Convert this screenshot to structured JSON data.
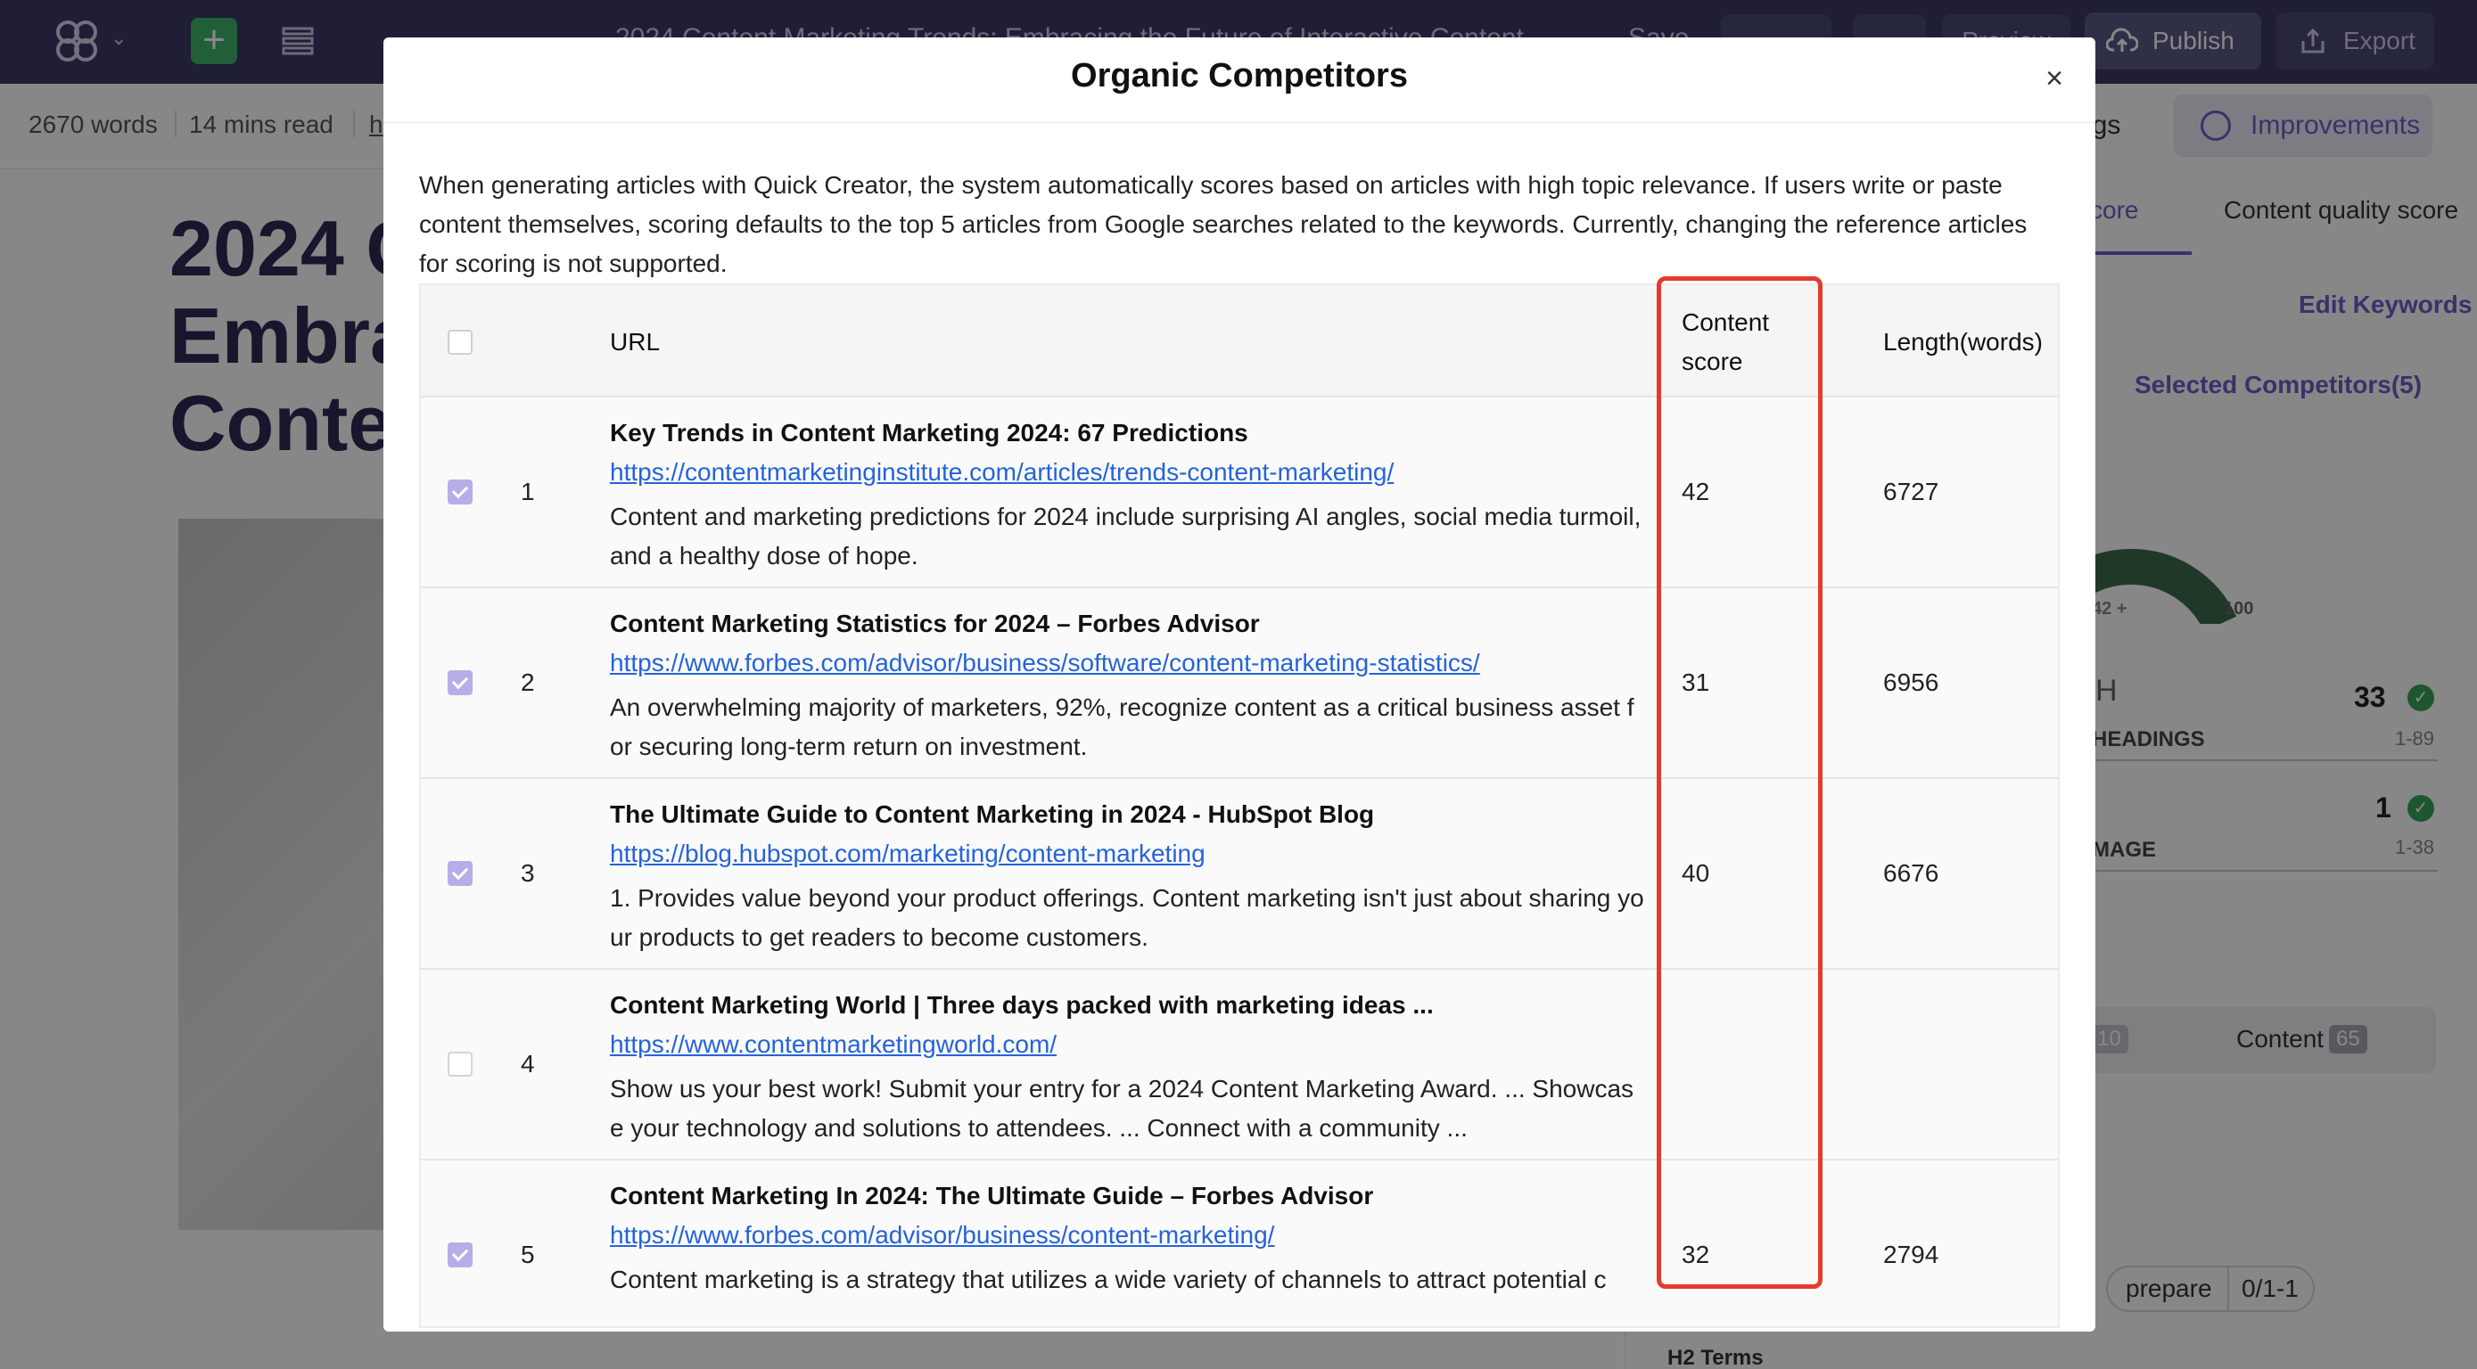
{
  "app": {
    "doc_title": "2024 Content Marketing Trends: Embracing the Future of Interactive Content",
    "save_label": "Save",
    "preview_label": "Preview",
    "publish_label": "Publish",
    "export_label": "Export"
  },
  "stats": {
    "words": "2670 words",
    "read_time": "14 mins read",
    "link_fragment": "h"
  },
  "article": {
    "title_lines": [
      "2024 C",
      "Embra",
      "Conte"
    ]
  },
  "right_panel": {
    "settings_fragment": "ngs",
    "improvements_label": "Improvements",
    "tab_score_fragment": "core",
    "tab_quality": "Content quality score",
    "edit_keywords": "Edit Keywords",
    "selected_competitors": "Selected Competitors(5)",
    "gauge_left_label": "42 +",
    "gauge_right_label": "100",
    "metric_headings_icon": "H",
    "metric_headings_value": "33",
    "metric_headings_label": "HEADINGS",
    "metric_headings_range": "1-89",
    "metric_image_value": "1",
    "metric_image_label": "MAGE",
    "metric_image_range": "1-38",
    "tag_count_1": "10",
    "tag_content_label": "Content",
    "tag_count_2": "65",
    "prepare_label": "prepare",
    "prepare_value": "0/1-1",
    "h2_terms": "H2 Terms"
  },
  "modal": {
    "title": "Organic Competitors",
    "close_symbol": "×",
    "description": "When generating articles with Quick Creator, the system automatically scores based on articles with high topic relevance. If users write or paste content themselves, scoring defaults to the top 5 articles from Google searches related to the keywords. Currently, changing the reference articles for scoring is not supported.",
    "columns": {
      "url": "URL",
      "content_score": "Content score",
      "length": "Length(words)"
    },
    "rows": [
      {
        "index": "1",
        "checked": true,
        "title": "Key Trends in Content Marketing 2024: 67 Predictions",
        "url": "https://contentmarketinginstitute.com/articles/trends-content-marketing/",
        "description": "Content and marketing predictions for 2024 include surprising AI angles, social media turmoil, and a healthy dose of hope.",
        "score": "42",
        "length": "6727"
      },
      {
        "index": "2",
        "checked": true,
        "title": "Content Marketing Statistics for 2024 – Forbes Advisor",
        "url": "https://www.forbes.com/advisor/business/software/content-marketing-statistics/",
        "description": "An overwhelming majority of marketers, 92%, recognize content as a critical business asset for securing long-term return on investment.",
        "score": "31",
        "length": "6956"
      },
      {
        "index": "3",
        "checked": true,
        "title": "The Ultimate Guide to Content Marketing in 2024 - HubSpot Blog",
        "url": "https://blog.hubspot.com/marketing/content-marketing",
        "description": "1. Provides value beyond your product offerings. Content marketing isn't just about sharing your products to get readers to become customers.",
        "score": "40",
        "length": "6676"
      },
      {
        "index": "4",
        "checked": false,
        "title": "Content Marketing World | Three days packed with marketing ideas ...",
        "url": "https://www.contentmarketingworld.com/",
        "description": "Show us your best work! Submit your entry for a 2024 Content Marketing Award. ... Showcase your technology and solutions to attendees. ... Connect with a community ...",
        "score": "",
        "length": ""
      },
      {
        "index": "5",
        "checked": true,
        "title": "Content Marketing In 2024: The Ultimate Guide – Forbes Advisor",
        "url": "https://www.forbes.com/advisor/business/content-marketing/",
        "description": "Content marketing is a strategy that utilizes a wide variety of channels to attract potential c",
        "score": "32",
        "length": "2794"
      }
    ]
  },
  "colors": {
    "topbar": "#3b3a66",
    "accent": "#6a5fc9",
    "highlight": "#e23c2e",
    "link": "#2563d9"
  }
}
